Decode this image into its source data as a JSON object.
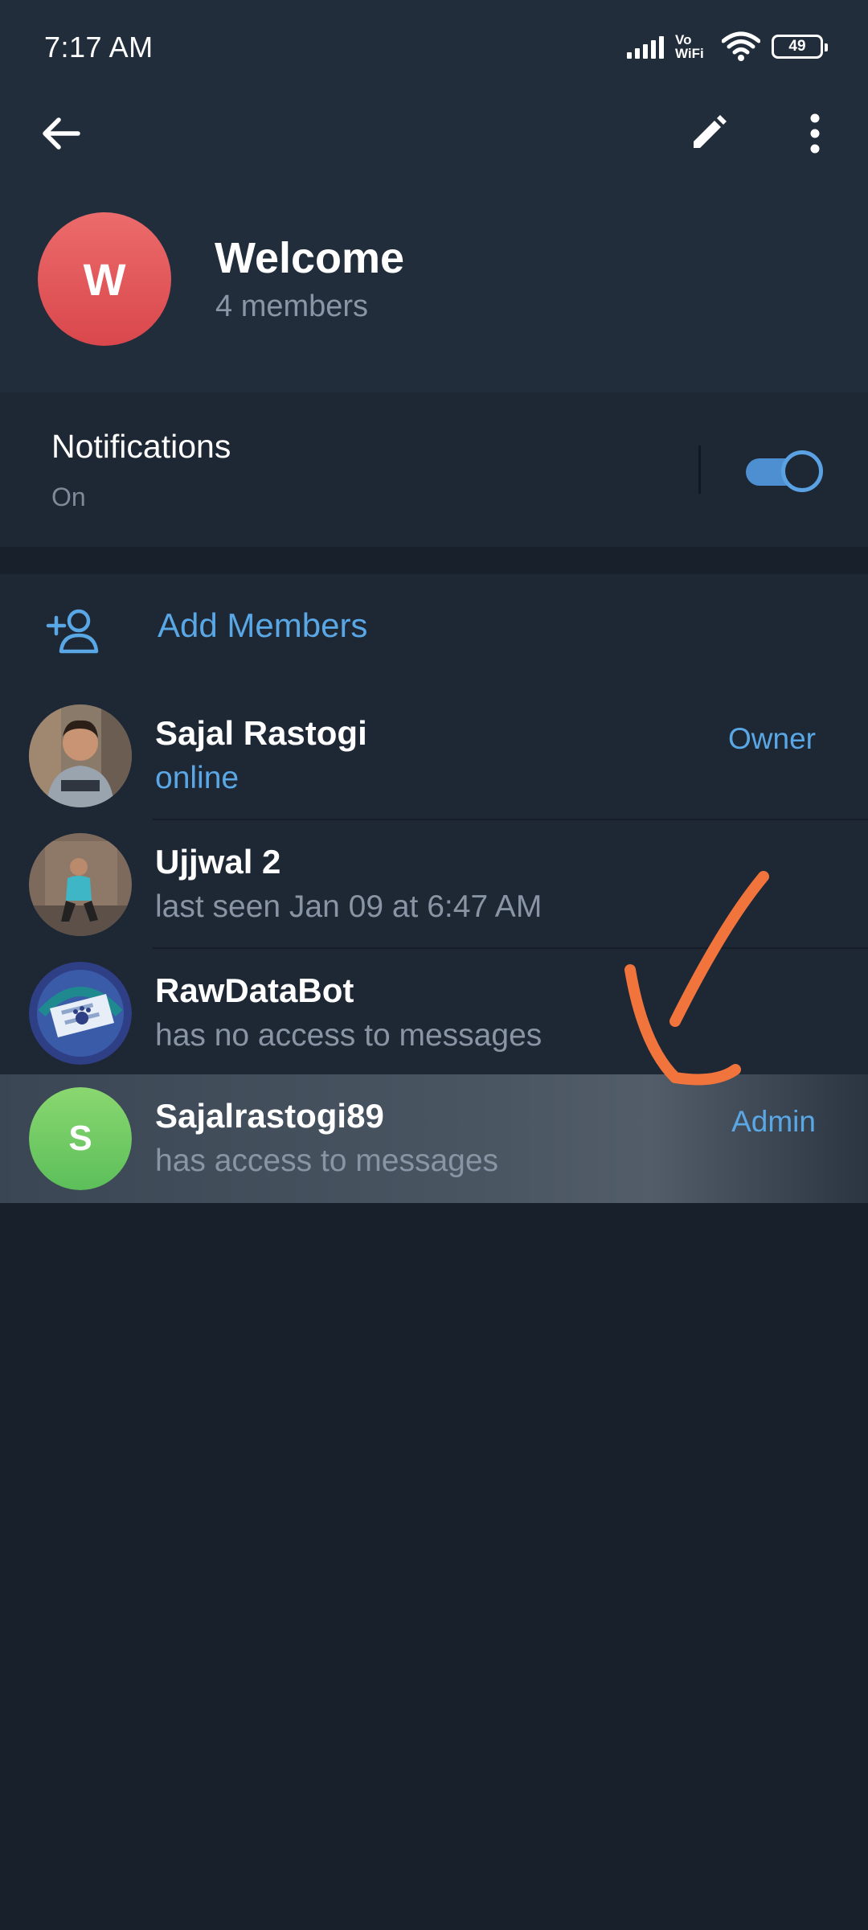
{
  "status_bar": {
    "time": "7:17 AM",
    "network_label": "Vo WiFi",
    "battery_level": "49"
  },
  "toolbar": {
    "back_icon": "arrow-left-icon",
    "edit_icon": "pencil-icon",
    "more_icon": "more-vertical-icon"
  },
  "group": {
    "avatar_letter": "W",
    "avatar_color": "#e25a5e",
    "title": "Welcome",
    "subtitle": "4 members"
  },
  "notifications": {
    "label": "Notifications",
    "value": "On",
    "enabled": true
  },
  "members": {
    "add_label": "Add Members",
    "list": [
      {
        "name": "Sajal Rastogi",
        "status": "online",
        "role": "Owner",
        "avatar": "photo"
      },
      {
        "name": "Ujjwal 2",
        "status": "last seen Jan 09 at 6:47 AM",
        "role": "",
        "avatar": "photo"
      },
      {
        "name": "RawDataBot",
        "status": "has no access to messages",
        "role": "",
        "avatar": "bot-logo"
      },
      {
        "name": "Sajalrastogi89",
        "status": "has access to messages",
        "role": "Admin",
        "avatar_letter": "S",
        "avatar_color": "#6cc964"
      }
    ]
  },
  "colors": {
    "accent": "#5aa7e6",
    "background": "#18202b",
    "header": "#222d3c",
    "annotation": "#f2743d"
  }
}
